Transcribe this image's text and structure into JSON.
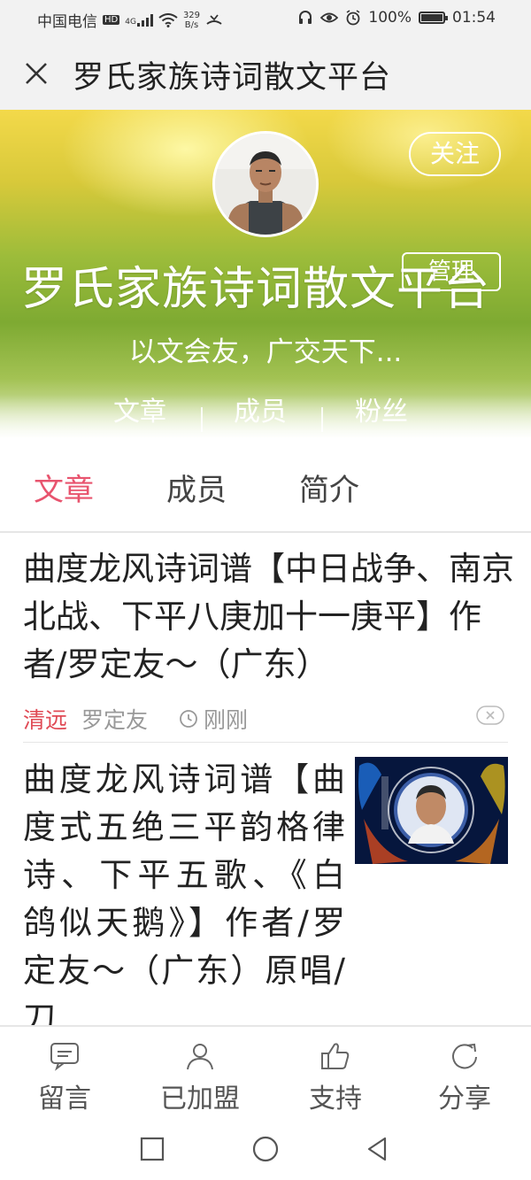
{
  "status_bar": {
    "carrier": "中国电信",
    "hd": "HD",
    "network": "4G",
    "speed_value": "329",
    "speed_unit": "B/s",
    "battery": "100%",
    "battery_level": 1.0,
    "time": "01:54"
  },
  "navbar": {
    "title": "罗氏家族诗词散文平台"
  },
  "hero": {
    "follow_label": "关注",
    "manage_label": "管理",
    "title": "罗氏家族诗词散文平台",
    "slogan": "以文会友，广交天下...",
    "stats": [
      {
        "label": "文章"
      },
      {
        "label": "成员"
      },
      {
        "label": "粉丝"
      }
    ]
  },
  "tabs": [
    {
      "label": "文章",
      "active": true
    },
    {
      "label": "成员",
      "active": false
    },
    {
      "label": "简介",
      "active": false
    }
  ],
  "articles": [
    {
      "title": "曲度龙风诗词谱【中日战争、南京北战、下平八庚加十一庚平】作者/罗定友～（广东）",
      "category": "清远",
      "author": "罗定友",
      "time": "刚刚"
    },
    {
      "title": "曲度龙风诗词谱【曲度式五绝三平韵格律诗、下平五歌、《白鸽似天鹅》】作者/罗定友～（广东）原唱/刀"
    }
  ],
  "toolbar": [
    {
      "label": "留言",
      "icon": "message-icon"
    },
    {
      "label": "已加盟",
      "icon": "user-icon"
    },
    {
      "label": "支持",
      "icon": "thumbs-up-icon"
    },
    {
      "label": "分享",
      "icon": "share-icon"
    }
  ],
  "colors": {
    "accent": "#e8546e",
    "category": "#e04a55",
    "bar_bg": "#f2f2f2"
  }
}
